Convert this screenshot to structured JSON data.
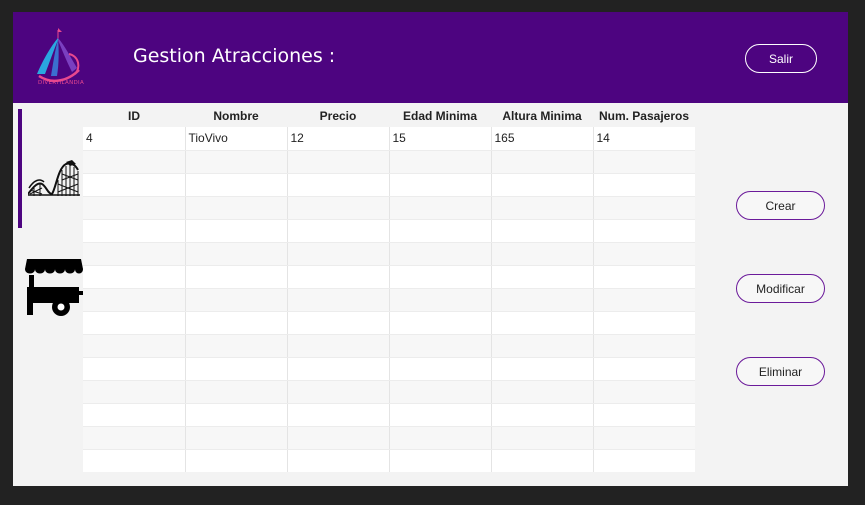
{
  "header": {
    "title": "Gestion Atracciones :",
    "logo_text": "DIVERTILANDIA",
    "salir_label": "Salir"
  },
  "actions": {
    "crear_label": "Crear",
    "modificar_label": "Modificar",
    "eliminar_label": "Eliminar"
  },
  "nav": [
    {
      "icon": "roller-coaster-icon",
      "selected": true
    },
    {
      "icon": "food-cart-icon",
      "selected": false
    }
  ],
  "table": {
    "columns": [
      "ID",
      "Nombre",
      "Precio",
      "Edad Minima",
      "Altura Minima",
      "Num. Pasajeros"
    ],
    "rows": [
      [
        "4",
        "TioVivo",
        "12",
        "15",
        "165",
        "14"
      ]
    ],
    "empty_rows": 14
  },
  "colors": {
    "header_bg": "#4d0480",
    "accent_border": "#6b1a9a",
    "logo_pink": "#e8488e",
    "logo_blue": "#2aa7e0"
  }
}
